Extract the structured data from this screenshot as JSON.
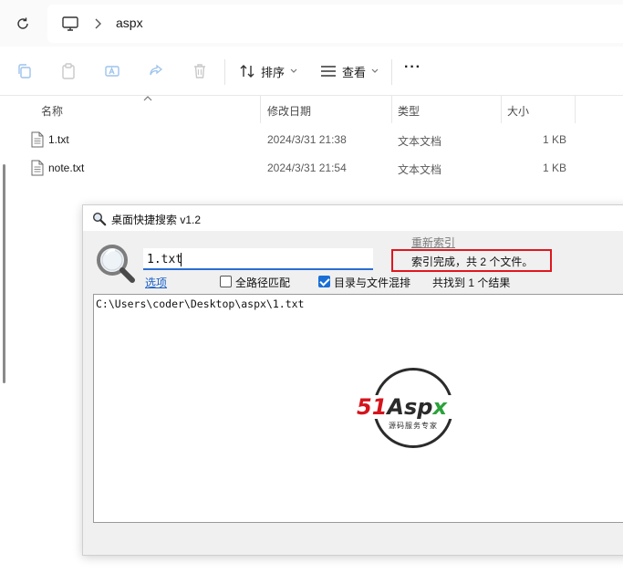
{
  "address_bar": {
    "refresh_icon": "refresh-icon",
    "computer_icon": "computer-icon",
    "current_folder": "aspx"
  },
  "command_bar": {
    "sort_label": "排序",
    "view_label": "查看",
    "more_label": "···"
  },
  "file_list": {
    "columns": [
      "名称",
      "修改日期",
      "类型",
      "大小"
    ],
    "rows": [
      {
        "name": "1.txt",
        "modified": "2024/3/31 21:38",
        "type": "文本文档",
        "size": "1 KB"
      },
      {
        "name": "note.txt",
        "modified": "2024/3/31 21:54",
        "type": "文本文档",
        "size": "1 KB"
      }
    ]
  },
  "search_app": {
    "title": "桌面快捷搜索 v1.2",
    "search_value": "1.txt",
    "reindex_link": "重新索引",
    "status_text": "索引完成，共 2 个文件。",
    "options_link": "选项",
    "full_path_match_label": "全路径匹配",
    "full_path_match_checked": false,
    "mix_dirs_files_label": "目录与文件混排",
    "mix_dirs_files_checked": true,
    "found_text": "共找到 1 个结果",
    "results": [
      "C:\\Users\\coder\\Desktop\\aspx\\1.txt"
    ],
    "watermark": {
      "brand": "51Aspx",
      "tagline": "源码服务专家"
    }
  },
  "colors": {
    "accent": "#1a6fd6",
    "highlight_box": "#e0161e",
    "brand_red": "#d4141c",
    "brand_green": "#2aa33a"
  }
}
